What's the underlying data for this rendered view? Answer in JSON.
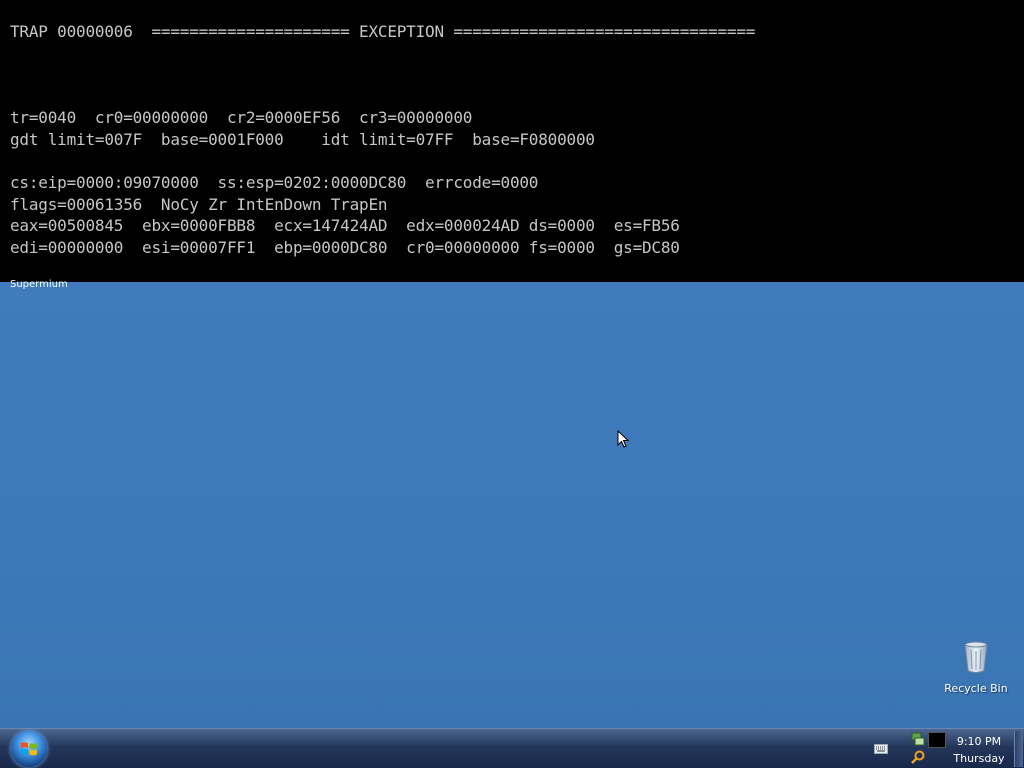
{
  "console": {
    "lines": [
      "TRAP 00000006  ===================== EXCEPTION ================================",
      "tr=0040  cr0=00000000  cr2=0000EF56  cr3=00000000",
      "gdt limit=007F  base=0001F000    idt limit=07FF  base=F0800000",
      "cs:eip=0000:09070000  ss:esp=0202:0000DC80  errcode=0000",
      "flags=00061356  NoCy Zr IntEnDown TrapEn",
      "eax=00500845  ebx=0000FBB8  ecx=147424AD  edx=000024AD ds=0000  es=FB56",
      "edi=00000000  esi=00007FF1  ebp=0000DC80  cr0=00000000 fs=0000  gs=DC80"
    ]
  },
  "window_caption": "Supermium",
  "desktop": {
    "icons": [
      {
        "label": "Recycle Bin",
        "icon": "recycle-bin-icon"
      }
    ]
  },
  "taskbar": {
    "start_icon": "windows-start-orb",
    "clock": {
      "time": "9:10 PM",
      "day": "Thursday"
    },
    "tray_icons": [
      "keyboard-icon",
      "network-icon",
      "search-icon",
      "black-window-icon"
    ]
  },
  "colors": {
    "desktop": "#3f7ab9",
    "console_bg": "#000000",
    "console_text": "#c6c6c6"
  }
}
